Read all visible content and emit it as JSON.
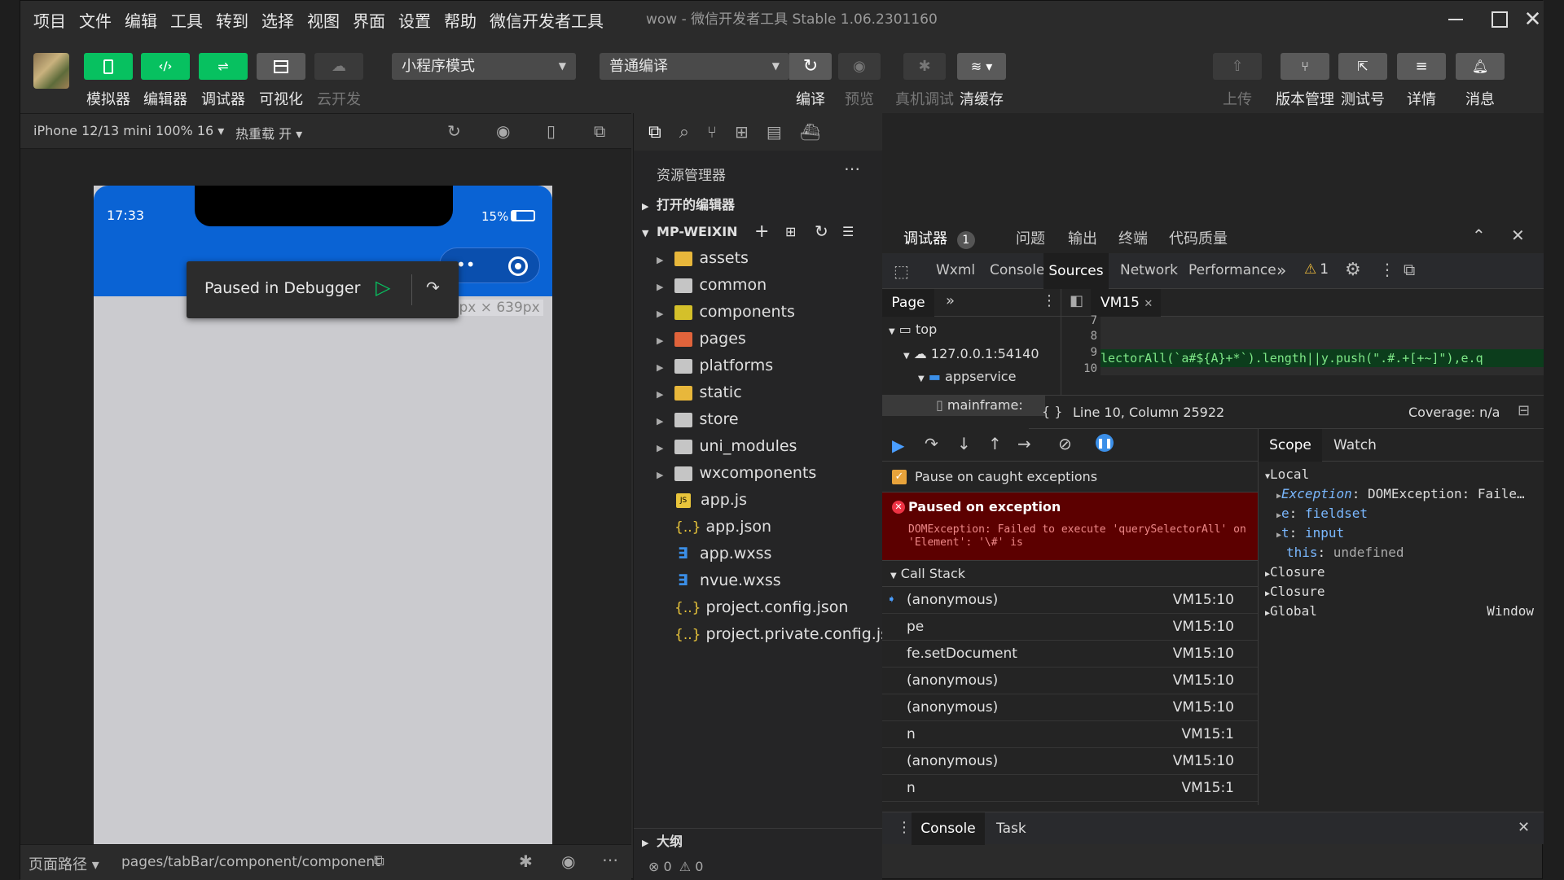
{
  "menubar": {
    "items": [
      "项目",
      "文件",
      "编辑",
      "工具",
      "转到",
      "选择",
      "视图",
      "界面",
      "设置",
      "帮助",
      "微信开发者工具"
    ],
    "title": "wow - 微信开发者工具 Stable 1.06.2301160"
  },
  "toolbar": {
    "left": [
      {
        "label": "模拟器",
        "icon": "phone-icon"
      },
      {
        "label": "编辑器",
        "icon": "code-icon"
      },
      {
        "label": "调试器",
        "icon": "debug-icon"
      },
      {
        "label": "可视化",
        "icon": "layout-icon"
      },
      {
        "label": "云开发",
        "icon": "cloud-icon"
      }
    ],
    "mode_select": "小程序模式",
    "compile_select": "普通编译",
    "mid": [
      {
        "label": "编译",
        "icon": "refresh-icon"
      },
      {
        "label": "预览",
        "icon": "eye-icon"
      },
      {
        "label": "真机调试",
        "icon": "bug-icon"
      },
      {
        "label": "清缓存",
        "icon": "layers-icon"
      }
    ],
    "right": [
      {
        "label": "上传",
        "icon": "upload-icon"
      },
      {
        "label": "版本管理",
        "icon": "branch-icon"
      },
      {
        "label": "测试号",
        "icon": "external-icon"
      },
      {
        "label": "详情",
        "icon": "menu-icon"
      },
      {
        "label": "消息",
        "icon": "bell-icon"
      }
    ]
  },
  "simulator": {
    "device": "iPhone 12/13 mini 100% 16",
    "hotreload": "热重载 开",
    "time": "17:33",
    "battery": "15%",
    "paused_text": "Paused in Debugger",
    "size_label": "375px × 639px"
  },
  "statusbar": {
    "path_label": "页面路径",
    "path": "pages/tabBar/component/component"
  },
  "explorer": {
    "title": "资源管理器",
    "open_editors": "打开的编辑器",
    "project": "MP-WEIXIN",
    "folders": [
      "assets",
      "common",
      "components",
      "pages",
      "platforms",
      "static",
      "store",
      "uni_modules",
      "wxcomponents"
    ],
    "files": [
      "app.js",
      "app.json",
      "app.wxss",
      "nvue.wxss",
      "project.config.json",
      "project.private.config.js..."
    ],
    "outline": "大纲",
    "errors": "0",
    "warnings": "0"
  },
  "devtools": {
    "top_tabs": [
      {
        "label": "调试器",
        "badge": "1"
      },
      {
        "label": "问题"
      },
      {
        "label": "输出"
      },
      {
        "label": "终端"
      },
      {
        "label": "代码质量"
      }
    ],
    "tabs": [
      "Wxml",
      "Console",
      "Sources",
      "Network",
      "Performance"
    ],
    "warn_count": "1",
    "page_tab": "Page",
    "file_tab": "VM15",
    "tree": {
      "top": "top",
      "host": "127.0.0.1:54140",
      "folder": "appservice",
      "file": "mainframe:"
    },
    "gutter": [
      "7",
      "8",
      "9",
      "10"
    ],
    "code_line": "lectorAll(`a#${A}+*`).length||y.push(\".#.+[+~]\"),e.q",
    "cursor": "Line 10, Column 25922",
    "coverage": "Coverage: n/a",
    "pause_caught": "Pause on caught exceptions",
    "exception_title": "Paused on exception",
    "exception_msg": "DOMException: Failed to execute 'querySelectorAll' on 'Element': '\\#' is",
    "callstack_title": "Call Stack",
    "callstack": [
      {
        "fn": "(anonymous)",
        "loc": "VM15:10"
      },
      {
        "fn": "pe",
        "loc": "VM15:10"
      },
      {
        "fn": "fe.setDocument",
        "loc": "VM15:10"
      },
      {
        "fn": "(anonymous)",
        "loc": "VM15:10"
      },
      {
        "fn": "(anonymous)",
        "loc": "VM15:10"
      },
      {
        "fn": "n",
        "loc": "VM15:1"
      },
      {
        "fn": "(anonymous)",
        "loc": "VM15:10"
      },
      {
        "fn": "n",
        "loc": "VM15:1"
      }
    ],
    "scope_tab": "Scope",
    "watch_tab": "Watch",
    "scope": {
      "local": "Local",
      "exception_key": "Exception",
      "exception_val": "DOMException: Faile…",
      "e_key": "e",
      "e_val": "fieldset",
      "t_key": "t",
      "t_val": "input",
      "this_key": "this",
      "this_val": "undefined",
      "closure": "Closure",
      "global": "Global",
      "global_val": "Window"
    },
    "drawer_tabs": [
      "Console",
      "Task"
    ]
  },
  "colors": {
    "accent_green": "#07c160",
    "blue": "#0a63d4",
    "exception_bg": "#5c0000"
  }
}
